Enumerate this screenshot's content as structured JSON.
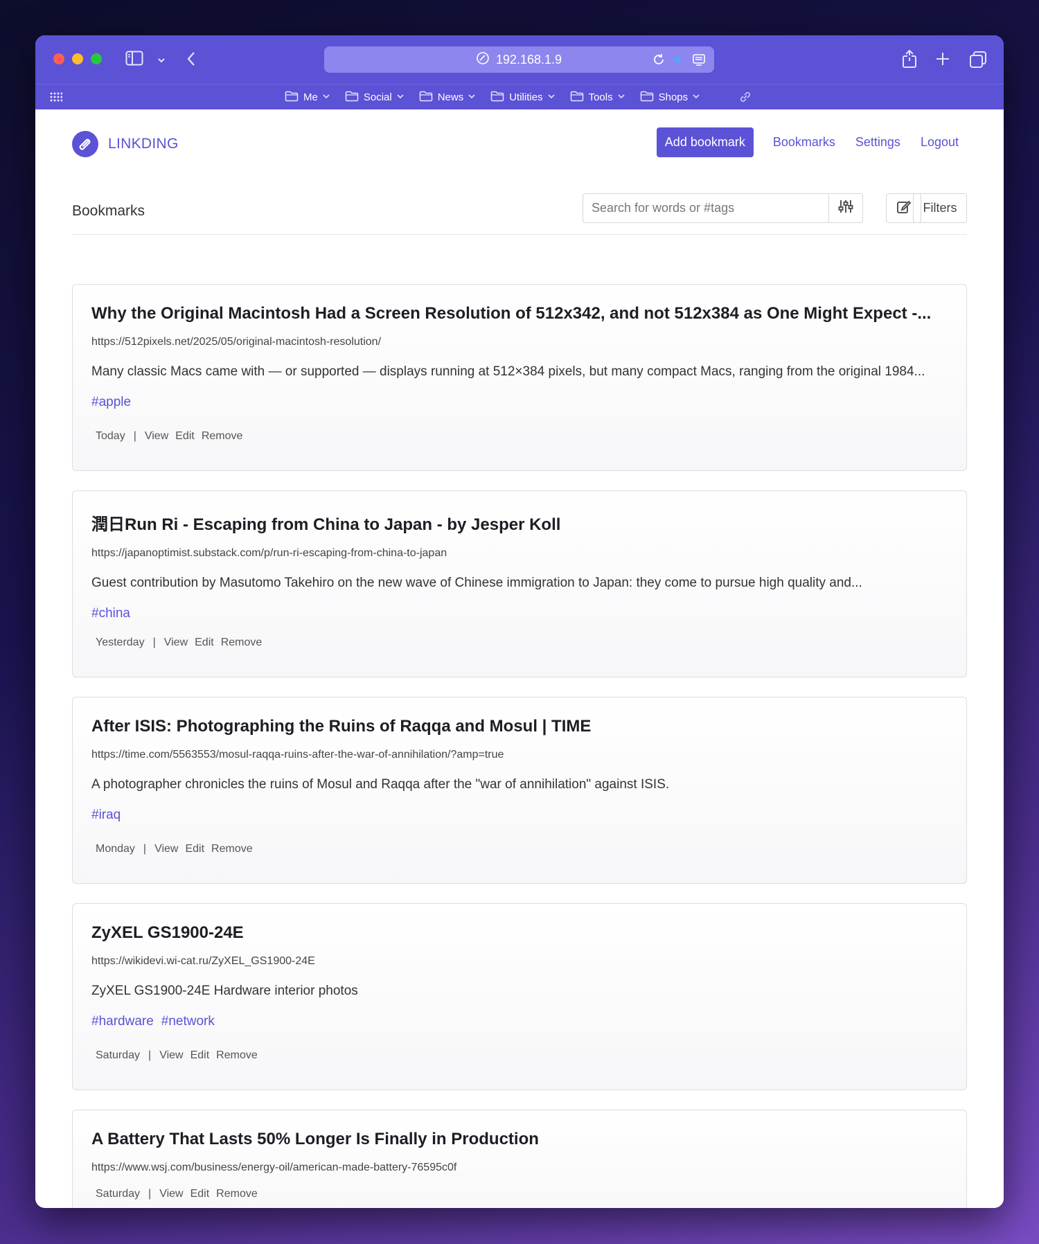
{
  "browser": {
    "address": "192.168.1.9",
    "bookmarks_bar": [
      {
        "label": "Me"
      },
      {
        "label": "Social"
      },
      {
        "label": "News"
      },
      {
        "label": "Utilities"
      },
      {
        "label": "Tools"
      },
      {
        "label": "Shops"
      }
    ]
  },
  "app": {
    "logo_text": "LINKDING",
    "nav": {
      "add_bookmark": "Add bookmark",
      "bookmarks": "Bookmarks",
      "settings": "Settings",
      "logout": "Logout"
    },
    "section_title": "Bookmarks",
    "search_placeholder": "Search for words or #tags",
    "filters_label": "Filters",
    "accent_color": "#5b52d6"
  },
  "bookmarks": [
    {
      "title": "Why the Original Macintosh Had a Screen Resolution of 512x342, and not 512x384 as One Might Expect -...",
      "url": "https://512pixels.net/2025/05/original-macintosh-resolution/",
      "description": "Many classic Macs came with — or supported — displays running at 512×384 pixels, but many compact Macs, ranging from the original 1984...",
      "tags": [
        "#apple"
      ],
      "date": "Today",
      "actions": {
        "separator": "|",
        "view": "View",
        "edit": "Edit",
        "remove": "Remove"
      }
    },
    {
      "title": "潤日Run Ri - Escaping from China to Japan - by Jesper Koll",
      "url": "https://japanoptimist.substack.com/p/run-ri-escaping-from-china-to-japan",
      "description": "Guest contribution by Masutomo Takehiro on the new wave of Chinese immigration to Japan: they come to pursue high quality and...",
      "tags": [
        "#china"
      ],
      "date": "Yesterday",
      "actions": {
        "separator": "|",
        "view": "View",
        "edit": "Edit",
        "remove": "Remove"
      }
    },
    {
      "title": "After ISIS: Photographing the Ruins of Raqqa and Mosul | TIME",
      "url": "https://time.com/5563553/mosul-raqqa-ruins-after-the-war-of-annihilation/?amp=true",
      "description": "A photographer chronicles the ruins of Mosul and Raqqa after the \"war of annihilation\" against ISIS.",
      "tags": [
        "#iraq"
      ],
      "date": "Monday",
      "actions": {
        "separator": "|",
        "view": "View",
        "edit": "Edit",
        "remove": "Remove"
      }
    },
    {
      "title": "ZyXEL GS1900-24E",
      "url": "https://wikidevi.wi-cat.ru/ZyXEL_GS1900-24E",
      "description": "ZyXEL GS1900-24E Hardware interior photos",
      "tags": [
        "#hardware",
        "#network"
      ],
      "date": "Saturday",
      "actions": {
        "separator": "|",
        "view": "View",
        "edit": "Edit",
        "remove": "Remove"
      }
    },
    {
      "title": "A Battery That Lasts 50% Longer Is Finally in Production",
      "url": "https://www.wsj.com/business/energy-oil/american-made-battery-76595c0f",
      "description": "",
      "tags": [],
      "date": "Saturday",
      "actions": {
        "separator": "|",
        "view": "View",
        "edit": "Edit",
        "remove": "Remove"
      }
    }
  ]
}
